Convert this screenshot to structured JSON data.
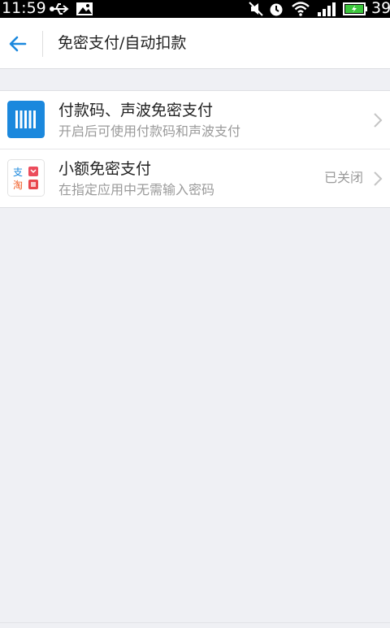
{
  "status_bar": {
    "time": "11:59",
    "battery_text": "39"
  },
  "header": {
    "title": "免密支付/自动扣款"
  },
  "rows": [
    {
      "title": "付款码、声波免密支付",
      "subtitle": "开启后可使用付款码和声波支付",
      "status": ""
    },
    {
      "title": "小额免密支付",
      "subtitle": "在指定应用中无需输入密码",
      "status": "已关闭",
      "icon_chars": [
        "支",
        "淘"
      ]
    }
  ],
  "colors": {
    "accent": "#1b88dd",
    "bg": "#eff0f4"
  }
}
